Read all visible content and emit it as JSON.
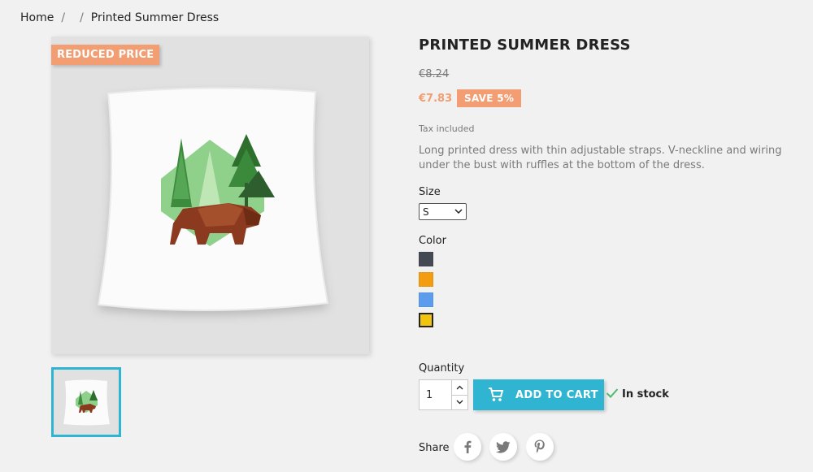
{
  "breadcrumb": {
    "items": [
      "Home",
      "",
      "Printed Summer Dress"
    ],
    "separator": "/"
  },
  "product": {
    "flag": "REDUCED PRICE",
    "title": "PRINTED SUMMER DRESS",
    "old_price": "€8.24",
    "price": "€7.83",
    "discount": "SAVE 5%",
    "tax_note": "Tax included",
    "description": "Long printed dress with thin adjustable straps. V-neckline and wiring under the bust with ruffles at the bottom of the dress."
  },
  "variants": {
    "size_label": "Size",
    "size_selected": "S",
    "color_label": "Color",
    "colors": [
      "#434a54",
      "#f39c11",
      "#5d9cec",
      "#f1c40f"
    ]
  },
  "cart": {
    "quantity_label": "Quantity",
    "quantity": "1",
    "add_to_cart": "ADD TO CART",
    "stock": "In stock"
  },
  "share": {
    "label": "Share",
    "networks": [
      "facebook-icon",
      "twitter-icon",
      "pinterest-icon"
    ]
  },
  "colors": {
    "accent": "#2fb5d2",
    "discount": "#f39d72"
  }
}
